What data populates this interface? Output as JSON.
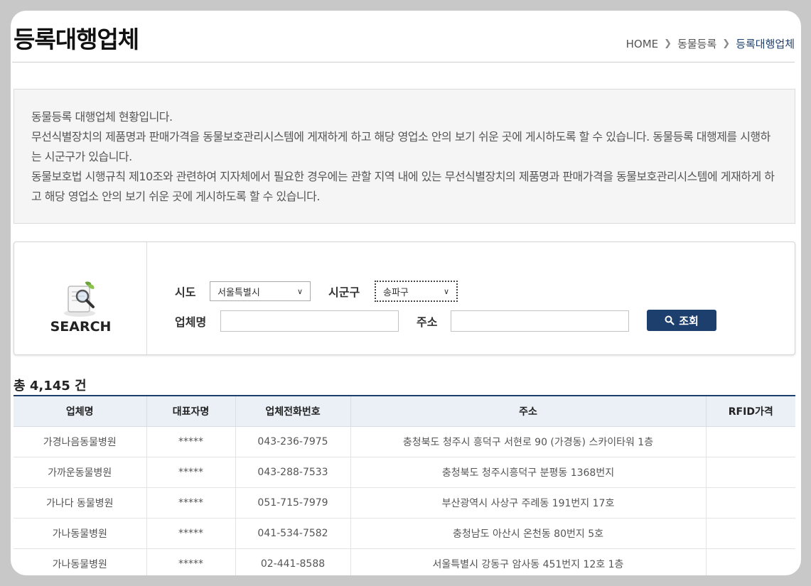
{
  "page": {
    "title": "등록대행업체"
  },
  "breadcrumb": {
    "home": "HOME",
    "parent": "동물등록",
    "current": "등록대행업체"
  },
  "notice": {
    "line1": "동물등록 대행업체 현황입니다.",
    "line2": "무선식별장치의 제품명과 판매가격을 동물보호관리시스템에 게재하게 하고 해당 영업소 안의 보기 쉬운 곳에 게시하도록 할 수 있습니다. 동물등록 대행제를 시행하는 시군구가 있습니다.",
    "line3": "동물보호법 시행규칙 제10조와 관련하여 지자체에서 필요한 경우에는 관할 지역 내에 있는 무선식별장치의 제품명과 판매가격을 동물보호관리시스템에 게재하게 하고 해당 영업소 안의 보기 쉬운 곳에 게시하도록 할 수 있습니다."
  },
  "search": {
    "label": "SEARCH",
    "sido_label": "시도",
    "sido_value": "서울특별시",
    "sigungu_label": "시군구",
    "sigungu_value": "송파구",
    "company_label": "업체명",
    "company_value": "",
    "address_label": "주소",
    "address_value": "",
    "button_label": "조회"
  },
  "total": "총 4,145 건",
  "table": {
    "headers": [
      "업체명",
      "대표자명",
      "업체전화번호",
      "주소",
      "RFID가격"
    ],
    "rows": [
      [
        "가경나음동물병원",
        "*****",
        "043-236-7975",
        "충청북도 청주시 흥덕구 서현로 90 (가경동) 스카이타워 1층",
        ""
      ],
      [
        "가까운동물병원",
        "*****",
        "043-288-7533",
        "충청북도 청주시흥덕구 분평동 1368번지",
        ""
      ],
      [
        "가나다 동물병원",
        "*****",
        "051-715-7979",
        "부산광역시 사상구 주례동 191번지 17호",
        ""
      ],
      [
        "가나동물병원",
        "*****",
        "041-534-7582",
        "충청남도 아산시 온천동 80번지 5호",
        ""
      ],
      [
        "가나동물병원",
        "*****",
        "02-441-8588",
        "서울특별시 강동구 암사동 451번지 12호 1층",
        ""
      ]
    ]
  },
  "colors": {
    "accent": "#1d3f6e",
    "header_bg": "#eaf0f6",
    "notice_bg": "#f5f5f5"
  }
}
